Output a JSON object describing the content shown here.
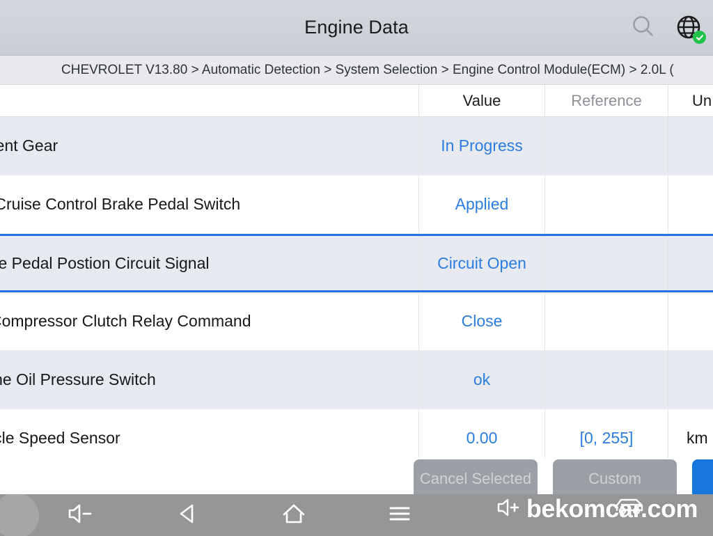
{
  "titlebar": {
    "title": "Engine Data",
    "search_icon": "search-icon",
    "globe_icon": "globe-icon",
    "badge_icon": "check-badge-icon"
  },
  "breadcrumb": {
    "text": "CHEVROLET V13.80 > Automatic Detection  > System Selection  > Engine Control Module(ECM)  > 2.0L ("
  },
  "table": {
    "headers": {
      "name": "",
      "value": "Value",
      "reference": "Reference",
      "unit": "Un"
    },
    "rows": [
      {
        "name": "rent Gear",
        "value": "In Progress",
        "reference": "",
        "unit": "",
        "striped": true,
        "selected": false
      },
      {
        "name": "/Cruise Control Brake Pedal Switch",
        "value": "Applied",
        "reference": "",
        "unit": "",
        "striped": false,
        "selected": false
      },
      {
        "name": "ke Pedal Postion Circuit Signal",
        "value": "Circuit Open",
        "reference": "",
        "unit": "",
        "striped": true,
        "selected": true
      },
      {
        "name": "Compressor Clutch Relay Command",
        "value": "Close",
        "reference": "",
        "unit": "",
        "striped": false,
        "selected": false
      },
      {
        "name": "ine Oil Pressure Switch",
        "value": "ok",
        "reference": "",
        "unit": "",
        "striped": true,
        "selected": false
      },
      {
        "name": "icle Speed Sensor",
        "value": "0.00",
        "reference": "[0, 255]",
        "unit": "km",
        "striped": false,
        "selected": false
      }
    ]
  },
  "buttons": {
    "cancel_selected": "Cancel Selected",
    "custom": "Custom",
    "primary": ""
  },
  "navbar": {
    "volume_down": "volume-down-icon",
    "back": "back-icon",
    "home": "home-icon",
    "menu": "menu-icon"
  },
  "watermark": {
    "text": "bekomcar.com",
    "speaker_icon": "speaker-plus-icon",
    "car_icon": "car-icon"
  },
  "colors": {
    "accent_blue": "#2b7de0",
    "selected_border": "#2272e0",
    "primary_button": "#1877dd",
    "row_stripe": "#e7eaf1",
    "badge_green": "#21c24a",
    "titlebar": "#cfd4da",
    "breadcrumb_bg": "#e8eaee",
    "navbar_bg": "#969696"
  }
}
